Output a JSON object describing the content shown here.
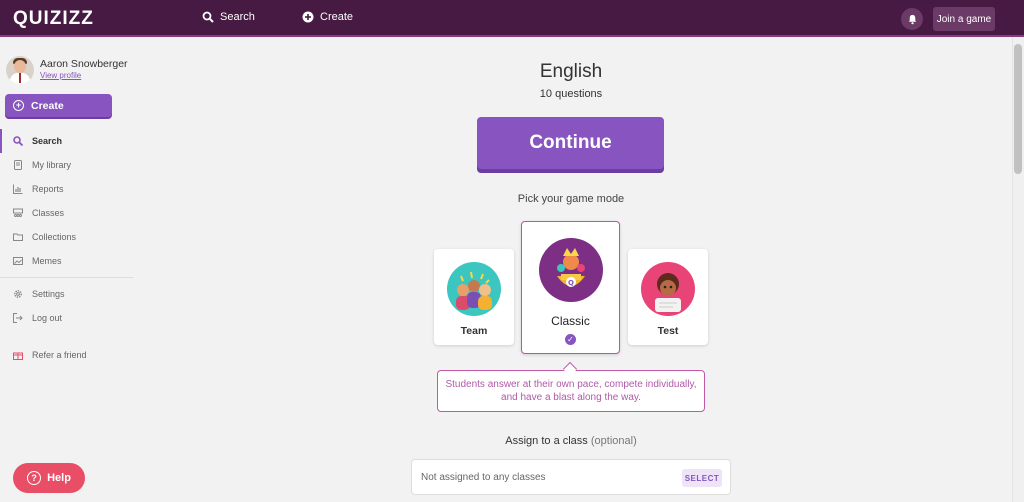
{
  "topbar": {
    "logo": "QUIZIZZ",
    "search_label": "Search",
    "create_label": "Create",
    "join_label": "Join a game"
  },
  "sidebar": {
    "profile_name": "Aaron Snowberger",
    "profile_link": "View profile",
    "create_label": "Create",
    "items": [
      {
        "label": "Search",
        "icon": "search-icon",
        "active": true
      },
      {
        "label": "My library",
        "icon": "library-icon"
      },
      {
        "label": "Reports",
        "icon": "reports-icon"
      },
      {
        "label": "Classes",
        "icon": "classes-icon"
      },
      {
        "label": "Collections",
        "icon": "folder-icon"
      },
      {
        "label": "Memes",
        "icon": "image-icon"
      }
    ],
    "bottom_items": [
      {
        "label": "Settings",
        "icon": "gear-icon"
      },
      {
        "label": "Log out",
        "icon": "logout-icon"
      }
    ],
    "refer_label": "Refer a friend",
    "help_label": "Help"
  },
  "main": {
    "quiz_title": "English",
    "question_count": "10 questions",
    "continue_label": "Continue",
    "pick_label": "Pick your game mode",
    "modes": [
      {
        "label": "Team"
      },
      {
        "label": "Classic",
        "selected": true
      },
      {
        "label": "Test"
      }
    ],
    "description": "Students answer at their own pace, compete individually, and have a blast along the way.",
    "assign_label": "Assign to a class",
    "assign_optional": "(optional)",
    "assign_placeholder": "Not assigned to any classes",
    "select_label": "SELECT"
  },
  "colors": {
    "topbar_bg": "#461a42",
    "accent": "#8854c0",
    "classic_border": "#b05aa8",
    "help": "#e84f66"
  }
}
